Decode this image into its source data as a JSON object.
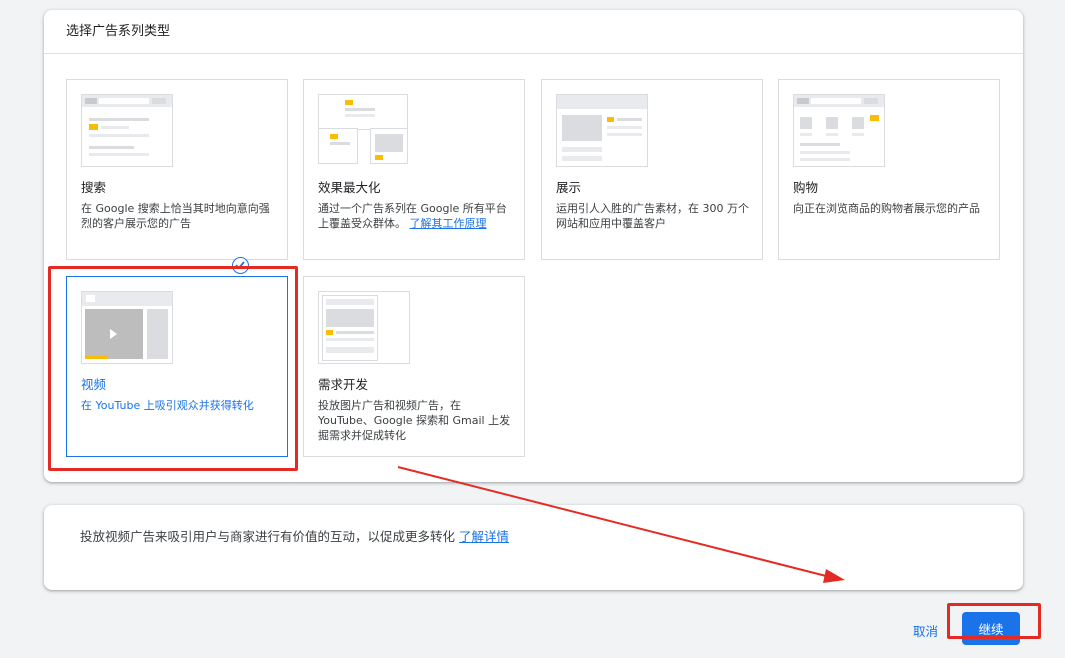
{
  "page": {
    "section_title": "选择广告系列类型",
    "tiles": [
      {
        "title": "搜索",
        "desc": "在 Google 搜索上恰当其时地向意向强烈的客户展示您的广告",
        "link": ""
      },
      {
        "title": "效果最大化",
        "desc": "通过一个广告系列在 Google 所有平台上覆盖受众群体。",
        "link": "了解其工作原理"
      },
      {
        "title": "展示",
        "desc": "运用引人入胜的广告素材，在 300 万个网站和应用中覆盖客户",
        "link": ""
      },
      {
        "title": "购物",
        "desc": "向正在浏览商品的购物者展示您的产品",
        "link": ""
      },
      {
        "title": "视频",
        "desc": "在 YouTube 上吸引观众并获得转化",
        "link": "",
        "selected": true
      },
      {
        "title": "需求开发",
        "desc": "投放图片广告和视频广告，在 YouTube、Google 探索和 Gmail 上发掘需求并促成转化",
        "link": ""
      }
    ],
    "info": {
      "text": "投放视频广告来吸引用户与商家进行有价值的互动，以促成更多转化",
      "link": "了解详情"
    },
    "actions": {
      "cancel_label": "取消",
      "continue_label": "继续"
    }
  },
  "colors": {
    "accent": "#1a73e8",
    "highlight": "#e42b23",
    "thumb_accent": "#fbbc04"
  }
}
